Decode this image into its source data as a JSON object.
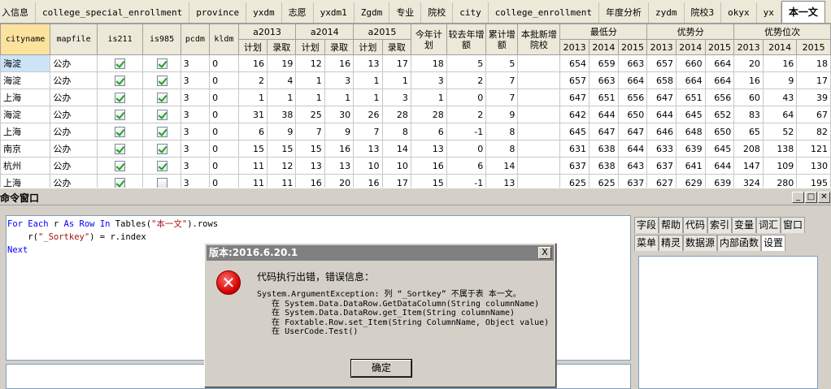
{
  "tabs": [
    "入信息",
    "college_special_enrollment",
    "province",
    "yxdm",
    "志愿",
    "yxdm1",
    "Zgdm",
    "专业",
    "院校",
    "city",
    "college_enrollment",
    "年度分析",
    "zydm",
    "院校3",
    "okyx",
    "yx",
    "本一文"
  ],
  "active_tab": "本一文",
  "grid": {
    "headers": {
      "cityname": "cityname",
      "mapfile": "mapfile",
      "is211": "is211",
      "is985": "is985",
      "pcdm": "pcdm",
      "kldm": "kldm",
      "a2013": "a2013",
      "a2014": "a2014",
      "a2015": "a2015",
      "plan": "计划",
      "admit": "录取",
      "this_year_plan": "今年计划",
      "vs_last_year": "较去年增额",
      "cumulative": "累计增额",
      "new_schools": "本批新增院校",
      "min_score": "最低分",
      "adv_score": "优势分",
      "adv_rank": "优势位次",
      "y2013": "2013",
      "y2014": "2014",
      "y2015": "2015"
    },
    "rows": [
      {
        "city": "海淀",
        "map": "公办",
        "is211": true,
        "is985": true,
        "pcdm": "3",
        "kldm": "0",
        "a13p": "16",
        "a13r": "19",
        "a14p": "12",
        "a14r": "16",
        "a15p": "13",
        "a15r": "17",
        "plan": "18",
        "inc": "5",
        "cum": "5",
        "min13": "654",
        "min14": "659",
        "min15": "663",
        "adv13": "657",
        "adv14": "660",
        "adv15": "664",
        "rk13": "20",
        "rk14": "16",
        "rk15": "18"
      },
      {
        "city": "海淀",
        "map": "公办",
        "is211": true,
        "is985": true,
        "pcdm": "3",
        "kldm": "0",
        "a13p": "2",
        "a13r": "4",
        "a14p": "1",
        "a14r": "3",
        "a15p": "1",
        "a15r": "1",
        "plan": "3",
        "inc": "2",
        "cum": "7",
        "min13": "657",
        "min14": "663",
        "min15": "664",
        "adv13": "658",
        "adv14": "664",
        "adv15": "664",
        "rk13": "16",
        "rk14": "9",
        "rk15": "17"
      },
      {
        "city": "上海",
        "map": "公办",
        "is211": true,
        "is985": true,
        "pcdm": "3",
        "kldm": "0",
        "a13p": "1",
        "a13r": "1",
        "a14p": "1",
        "a14r": "1",
        "a15p": "1",
        "a15r": "3",
        "plan": "1",
        "inc": "0",
        "cum": "7",
        "min13": "647",
        "min14": "651",
        "min15": "656",
        "adv13": "647",
        "adv14": "651",
        "adv15": "656",
        "rk13": "60",
        "rk14": "43",
        "rk15": "39"
      },
      {
        "city": "海淀",
        "map": "公办",
        "is211": true,
        "is985": true,
        "pcdm": "3",
        "kldm": "0",
        "a13p": "31",
        "a13r": "38",
        "a14p": "25",
        "a14r": "30",
        "a15p": "26",
        "a15r": "28",
        "plan": "28",
        "inc": "2",
        "cum": "9",
        "min13": "642",
        "min14": "644",
        "min15": "650",
        "adv13": "644",
        "adv14": "645",
        "adv15": "652",
        "rk13": "83",
        "rk14": "64",
        "rk15": "67"
      },
      {
        "city": "上海",
        "map": "公办",
        "is211": true,
        "is985": true,
        "pcdm": "3",
        "kldm": "0",
        "a13p": "6",
        "a13r": "9",
        "a14p": "7",
        "a14r": "9",
        "a15p": "7",
        "a15r": "8",
        "plan": "6",
        "inc": "-1",
        "cum": "8",
        "min13": "645",
        "min14": "647",
        "min15": "647",
        "adv13": "646",
        "adv14": "648",
        "adv15": "650",
        "rk13": "65",
        "rk14": "52",
        "rk15": "82"
      },
      {
        "city": "南京",
        "map": "公办",
        "is211": true,
        "is985": true,
        "pcdm": "3",
        "kldm": "0",
        "a13p": "15",
        "a13r": "15",
        "a14p": "15",
        "a14r": "16",
        "a15p": "13",
        "a15r": "14",
        "plan": "13",
        "inc": "0",
        "cum": "8",
        "min13": "631",
        "min14": "638",
        "min15": "644",
        "adv13": "633",
        "adv14": "639",
        "adv15": "645",
        "rk13": "208",
        "rk14": "138",
        "rk15": "121"
      },
      {
        "city": "杭州",
        "map": "公办",
        "is211": true,
        "is985": true,
        "pcdm": "3",
        "kldm": "0",
        "a13p": "11",
        "a13r": "12",
        "a14p": "13",
        "a14r": "13",
        "a15p": "10",
        "a15r": "10",
        "plan": "16",
        "inc": "6",
        "cum": "14",
        "min13": "637",
        "min14": "638",
        "min15": "643",
        "adv13": "637",
        "adv14": "641",
        "adv15": "644",
        "rk13": "147",
        "rk14": "109",
        "rk15": "130"
      },
      {
        "city": "上海",
        "map": "公办",
        "is211": true,
        "is985": false,
        "pcdm": "3",
        "kldm": "0",
        "a13p": "11",
        "a13r": "11",
        "a14p": "16",
        "a14r": "20",
        "a15p": "16",
        "a15r": "17",
        "plan": "15",
        "inc": "-1",
        "cum": "13",
        "min13": "625",
        "min14": "625",
        "min15": "637",
        "adv13": "627",
        "adv14": "629",
        "adv15": "639",
        "rk13": "324",
        "rk14": "280",
        "rk15": "195"
      }
    ]
  },
  "command_window": {
    "title": "命令窗口",
    "code": {
      "kw_for_each": "For Each",
      "var_r": " r ",
      "kw_as": "As",
      "kw_row": "Row",
      "kw_in": "In",
      "tables": " Tables(",
      "tbl_name": "\"本一文\"",
      "rows_suffix": ").rows",
      "line2_pre": "    r(",
      "key": "\"_Sortkey\"",
      "line2_post": ") = r.index",
      "kw_next": "Next"
    },
    "side_tabs_row1": [
      "字段",
      "帮助",
      "代码",
      "索引",
      "变量",
      "词汇",
      "窗口"
    ],
    "side_tabs_row2": [
      "菜单",
      "精灵",
      "数据源",
      "内部函数",
      "设置"
    ],
    "active_side_tab": "设置"
  },
  "dialog": {
    "title": "版本:2016.6.20.1",
    "close": "X",
    "heading": "代码执行出错，错误信息：",
    "body": "System.ArgumentException: 列 “_Sortkey” 不属于表 本一文。\n   在 System.Data.DataRow.GetDataColumn(String columnName)\n   在 System.Data.DataRow.get_Item(String columnName)\n   在 Foxtable.Row.set_Item(String ColumnName, Object value)\n   在 UserCode.Test()",
    "ok_label": "确定",
    "icon_glyph": "✕"
  },
  "window_buttons": {
    "minimize": "_",
    "restore": "□",
    "close": "✕"
  }
}
